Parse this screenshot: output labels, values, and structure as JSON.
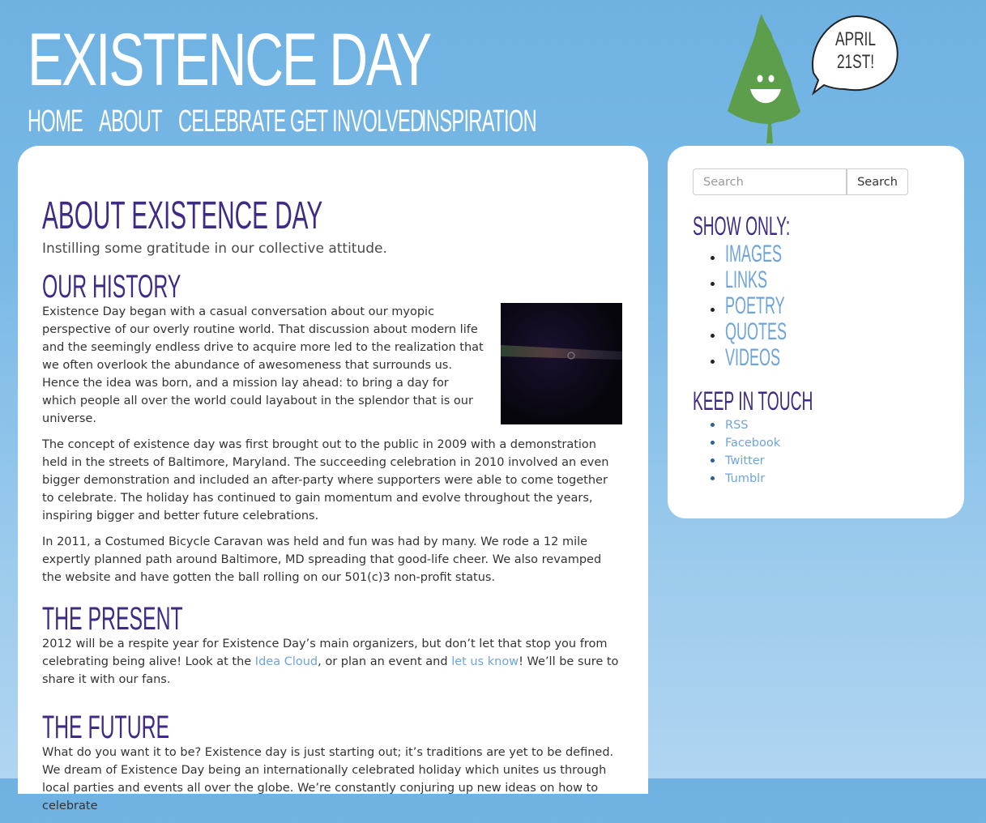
{
  "site": {
    "title": "EXISTENCE DAY",
    "date_bubble_line1": "APRIL",
    "date_bubble_line2": "21ST!"
  },
  "nav": {
    "items": [
      "HOME",
      "ABOUT",
      "CELEBRATE",
      "GET INVOLVED",
      "INSPIRATION"
    ]
  },
  "main": {
    "heading": "ABOUT EXISTENCE DAY",
    "subtitle": "Instilling some gratitude in our collective attitude.",
    "history": {
      "heading": "OUR HISTORY",
      "p1": "Existence Day began with a casual conversation about our myopic perspective of our overly routine world. That discussion about modern life and the seemingly endless drive to acquire more led to the realization that we often overlook the abundance of awesomeness that surrounds us. Hence the idea was born, and a mission lay ahead: to bring a day for which people all over the world could layabout in the splendor that is our universe.",
      "p2": "The concept of existence day was first brought out to the public in 2009 with a demonstration held in the streets of Baltimore, Maryland. The succeeding celebration in 2010 involved an even bigger demonstration and included an after-party where supporters were able to come together to celebrate. The holiday has continued to gain momentum and evolve throughout the years, inspiring bigger and better future celebrations.",
      "p3": "In 2011, a Costumed Bicycle Caravan was held and fun was had by many. We rode a 12 mile expertly planned path around Baltimore, MD spreading that good-life cheer. We also revamped the website and have gotten the ball rolling on our 501(c)3 non-profit status."
    },
    "present": {
      "heading": "THE PRESENT",
      "text_before": "2012 will be a respite year for Existence Day’s main organizers, but don’t let that stop you from celebrating being alive! Look at the ",
      "link1": "Idea Cloud",
      "text_middle": ", or plan an event and ",
      "link2": "let us know",
      "text_after": "! We’ll be sure to share it with our fans."
    },
    "future": {
      "heading": "THE FUTURE",
      "p1": "What do you want it to be? Existence day is just starting out; it’s traditions are yet to be defined. We dream of Existence Day being an internationally celebrated holiday which unites us through local parties and events all over the globe. We’re constantly conjuring up new ideas on how to celebrate"
    }
  },
  "sidebar": {
    "search": {
      "placeholder": "Search",
      "button": "Search"
    },
    "show_only": {
      "heading": "SHOW ONLY:",
      "items": [
        "IMAGES",
        "LINKS",
        "POETRY",
        "QUOTES",
        "VIDEOS"
      ]
    },
    "keep_in_touch": {
      "heading": "KEEP IN TOUCH",
      "items": [
        "RSS",
        "Facebook",
        "Twitter",
        "Tumblr"
      ]
    }
  },
  "colors": {
    "background": "#6fb2e2",
    "heading": "#3f2a85",
    "link": "#6ea4da",
    "tree": "#5c9e4c"
  }
}
